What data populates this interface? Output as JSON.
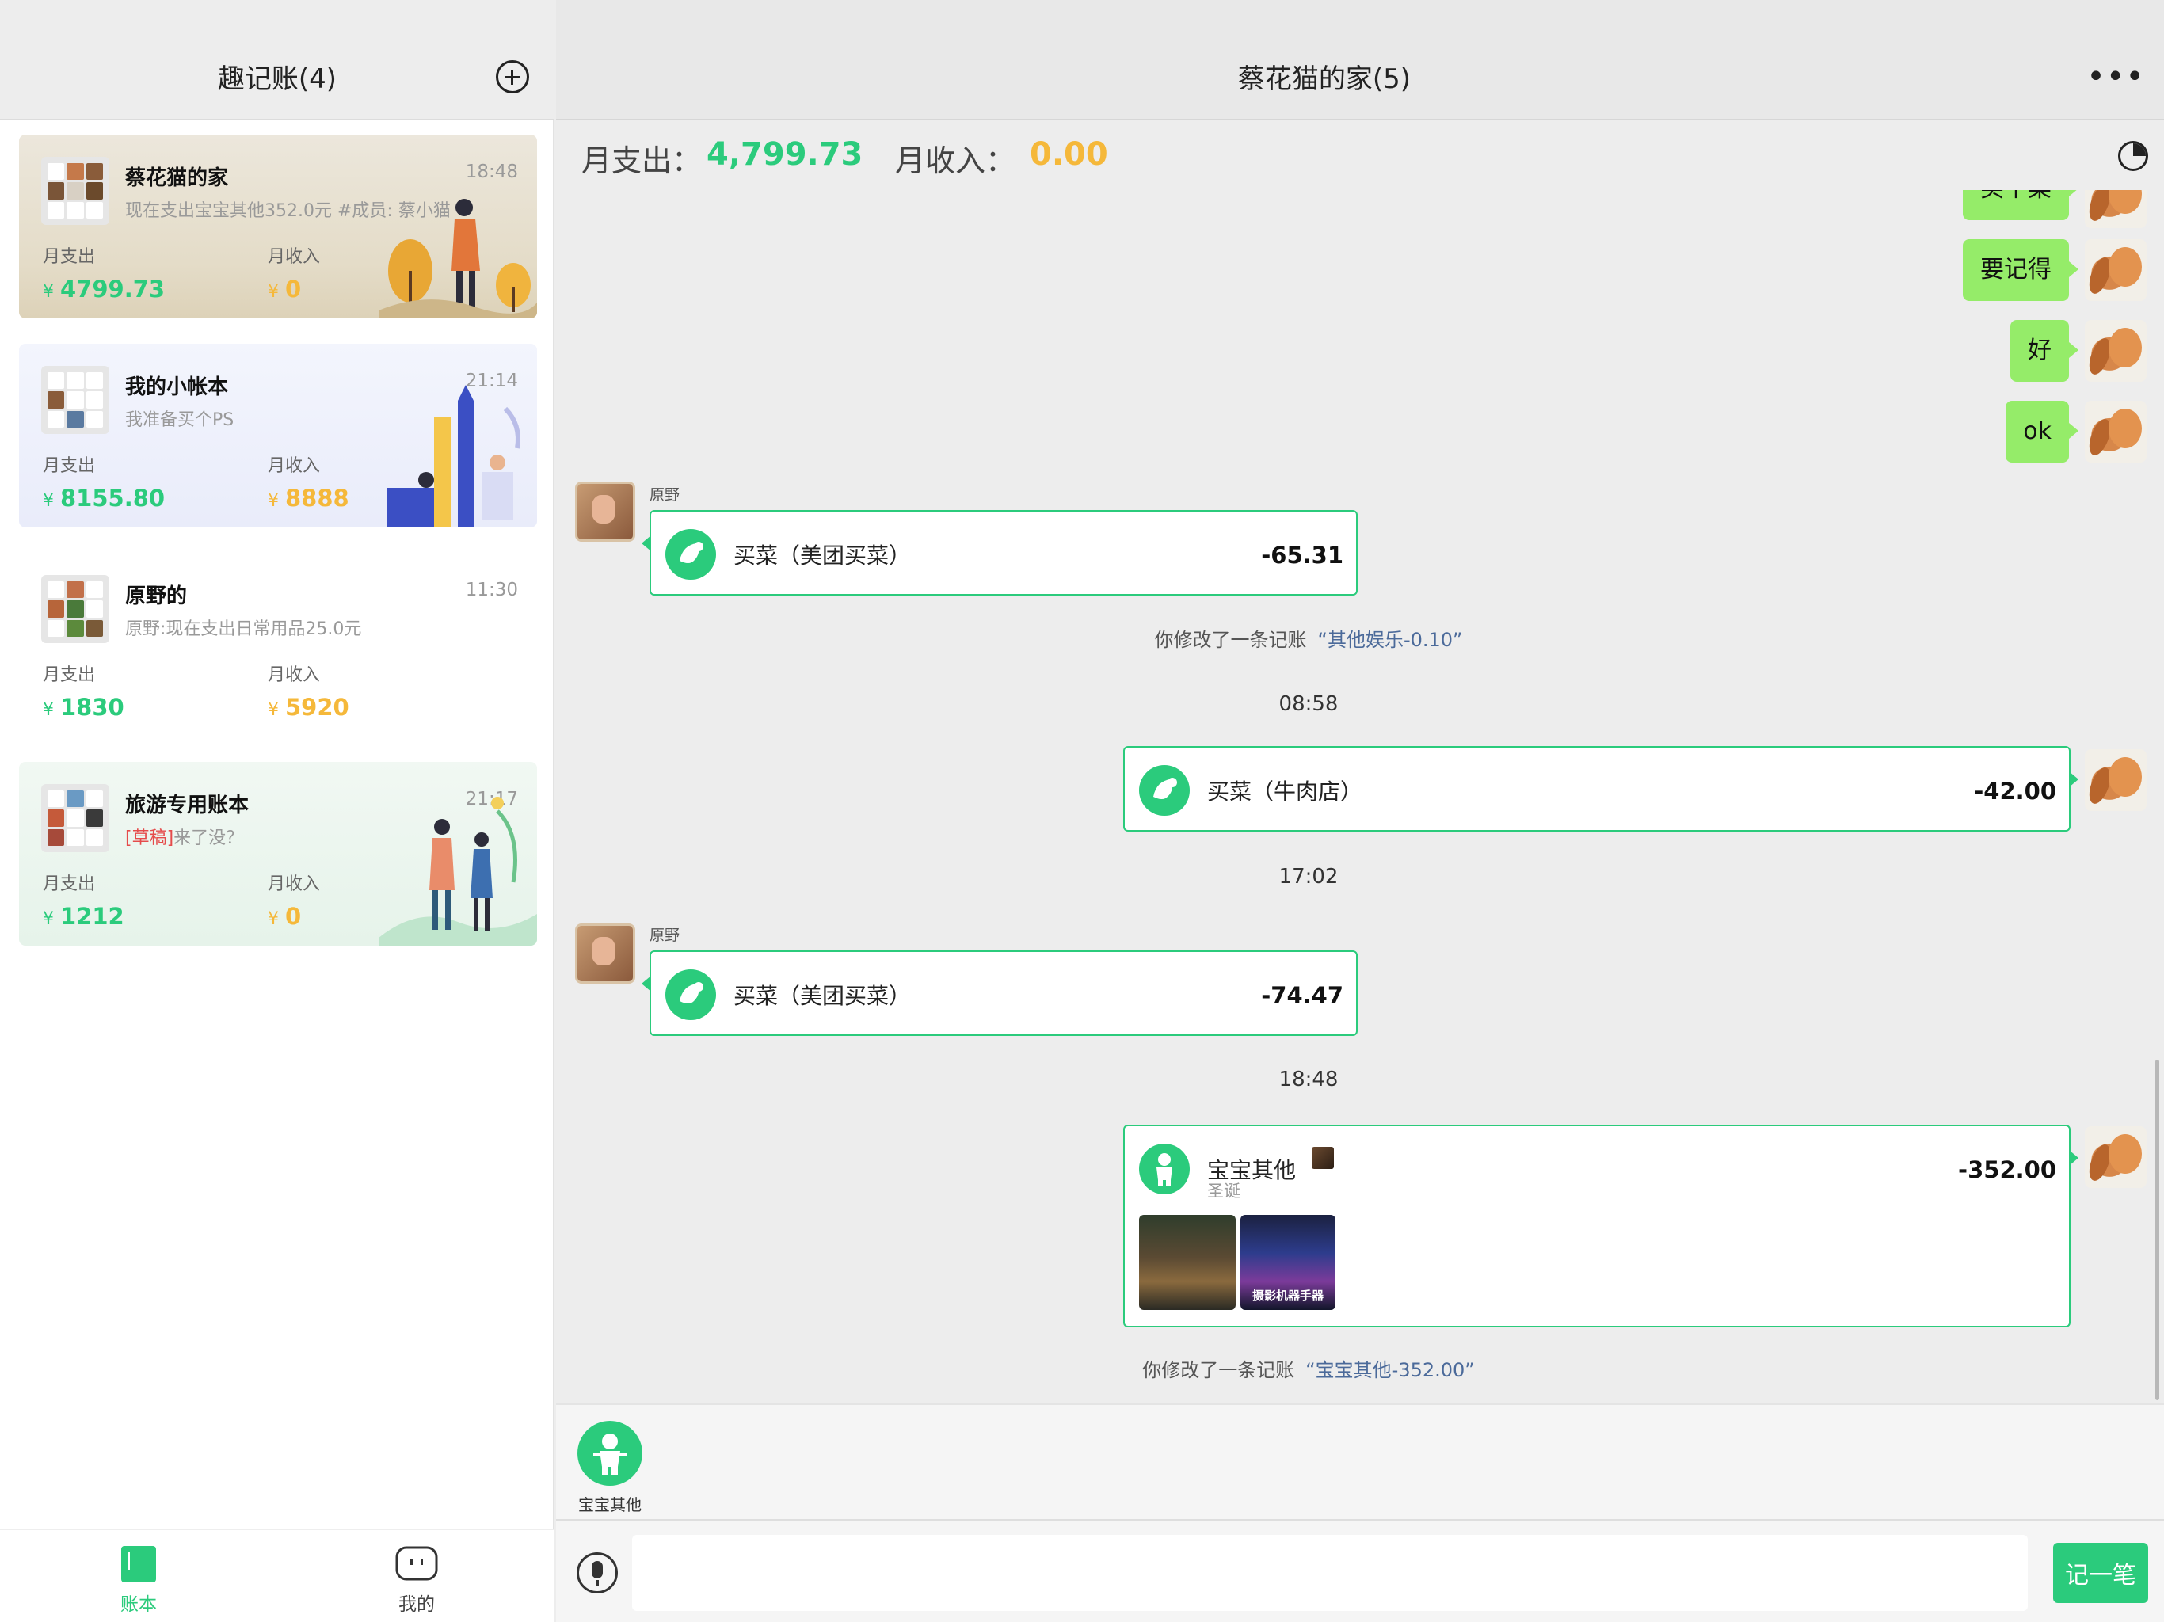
{
  "left": {
    "title": "趣记账(4)",
    "books": [
      {
        "name": "蔡花猫的家",
        "time": "18:48",
        "subtitle": "现在支出宝宝其他352.0元 #成员: 蔡小猫",
        "draft_tag": "",
        "exp_label": "月支出",
        "exp_value": "4799.73",
        "inc_label": "月收入",
        "inc_value": "0",
        "yen": "¥"
      },
      {
        "name": "我的小帐本",
        "time": "21:14",
        "subtitle": "我准备买个PS",
        "draft_tag": "",
        "exp_label": "月支出",
        "exp_value": "8155.80",
        "inc_label": "月收入",
        "inc_value": "8888",
        "yen": "¥"
      },
      {
        "name": "原野的",
        "time": "11:30",
        "subtitle": "原野:现在支出日常用品25.0元",
        "draft_tag": "",
        "exp_label": "月支出",
        "exp_value": "1830",
        "inc_label": "月收入",
        "inc_value": "5920",
        "yen": "¥"
      },
      {
        "name": "旅游专用账本",
        "time": "21:17",
        "subtitle": "来了没？",
        "draft_tag": "[草稿]",
        "exp_label": "月支出",
        "exp_value": "1212",
        "inc_label": "月收入",
        "inc_value": "0",
        "yen": "¥"
      }
    ],
    "tabs": [
      {
        "label": "账本",
        "icon": "book-icon"
      },
      {
        "label": "我的",
        "icon": "profile-icon"
      }
    ]
  },
  "chat": {
    "title": "蔡花猫的家(5)",
    "more": "•••",
    "summary": {
      "exp_label": "月支出：",
      "exp_value": "4,799.73",
      "inc_label": "月收入：",
      "inc_value": "0.00"
    },
    "messages": {
      "partial_bubble": "买个菜",
      "bubble1": "要记得",
      "bubble2": "好",
      "bubble3": "ok",
      "sender1": "原野",
      "rec1_label": "买菜（美团买菜）",
      "rec1_amount": "-65.31",
      "sys1_text": "你修改了一条记账",
      "sys1_quote": "“其他娱乐-0.10”",
      "time1": "08:58",
      "rec2_label": "买菜（牛肉店）",
      "rec2_amount": "-42.00",
      "time2": "17:02",
      "sender2": "原野",
      "rec3_label": "买菜（美团买菜）",
      "rec3_amount": "-74.47",
      "time3": "18:48",
      "rec4_label": "宝宝其他",
      "rec4_note": "圣诞",
      "rec4_amount": "-352.00",
      "rec4_photo2_text": "摄影机器手器",
      "sys2_text": "你修改了一条记账",
      "sys2_quote": "“宝宝其他-352.00”"
    },
    "quick": {
      "label": "宝宝其他",
      "icon": "baby-icon"
    },
    "input": {
      "value": "",
      "submit": "记一笔",
      "mic_icon": "microphone-icon"
    }
  },
  "colors": {
    "accent_green": "#2bcb7c",
    "income_orange": "#f5b83a",
    "bubble_green": "#95ec69",
    "draft_red": "#e54b4b"
  }
}
